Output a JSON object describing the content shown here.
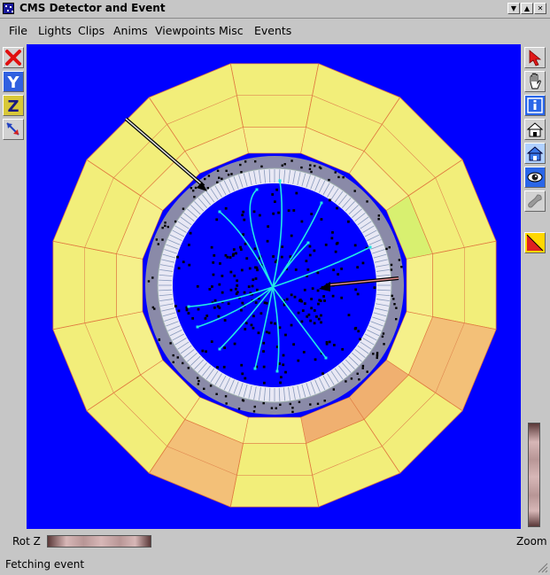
{
  "window": {
    "title": "CMS Detector and Event"
  },
  "menu": [
    "File",
    "Lights",
    "Clips",
    "Anims",
    "Viewpoints",
    "Misc",
    "Events"
  ],
  "left_tools": [
    {
      "name": "close-x-icon"
    },
    {
      "name": "y-axis-icon",
      "glyph": "Y"
    },
    {
      "name": "z-axis-icon",
      "glyph": "Z"
    },
    {
      "name": "seek-arrows-icon"
    }
  ],
  "right_tools": [
    {
      "name": "pointer-arrow-icon"
    },
    {
      "name": "hand-icon"
    },
    {
      "name": "info-icon"
    },
    {
      "name": "home-icon"
    },
    {
      "name": "set-home-icon"
    },
    {
      "name": "view-all-eye-icon"
    },
    {
      "name": "seek-tool-icon"
    },
    {
      "name": "perspective-toggle-icon"
    }
  ],
  "thumbwheels": {
    "rot_label": "Rot Z",
    "zoom_label": "Zoom"
  },
  "status": {
    "text": "Fetching event"
  },
  "colors": {
    "background": "#0000ff",
    "calorimeter": "#f2ee7a",
    "tracker": "#aaaaaa",
    "tracks": "#22e6e6"
  }
}
